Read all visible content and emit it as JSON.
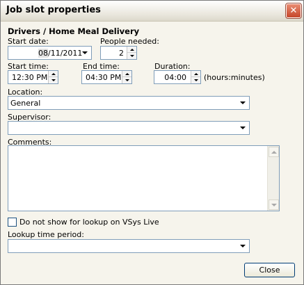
{
  "window": {
    "title": "Job slot properties",
    "close_glyph": "✕"
  },
  "job": {
    "heading": "Drivers / Home Meal Delivery"
  },
  "start_date": {
    "label": "Start date:",
    "value": "08/11/2011"
  },
  "people_needed": {
    "label": "People needed:",
    "value": "2"
  },
  "start_time": {
    "label": "Start time:",
    "value": "12:30 PM"
  },
  "end_time": {
    "label": "End time:",
    "value": "04:30 PM"
  },
  "duration": {
    "label": "Duration:",
    "value": "04:00",
    "unit": "(hours:minutes)"
  },
  "location": {
    "label": "Location:",
    "value": "General"
  },
  "supervisor": {
    "label": "Supervisor:",
    "value": ""
  },
  "comments": {
    "label": "Comments:",
    "value": ""
  },
  "lookup_checkbox": {
    "label": "Do not show for lookup on VSys Live",
    "checked": false
  },
  "lookup_period": {
    "label": "Lookup time period:",
    "value": ""
  },
  "buttons": {
    "close": "Close"
  },
  "colors": {
    "field_border": "#7f9db9",
    "dialog_bg": "#f6f4ec",
    "close_red": "#c5462b"
  }
}
